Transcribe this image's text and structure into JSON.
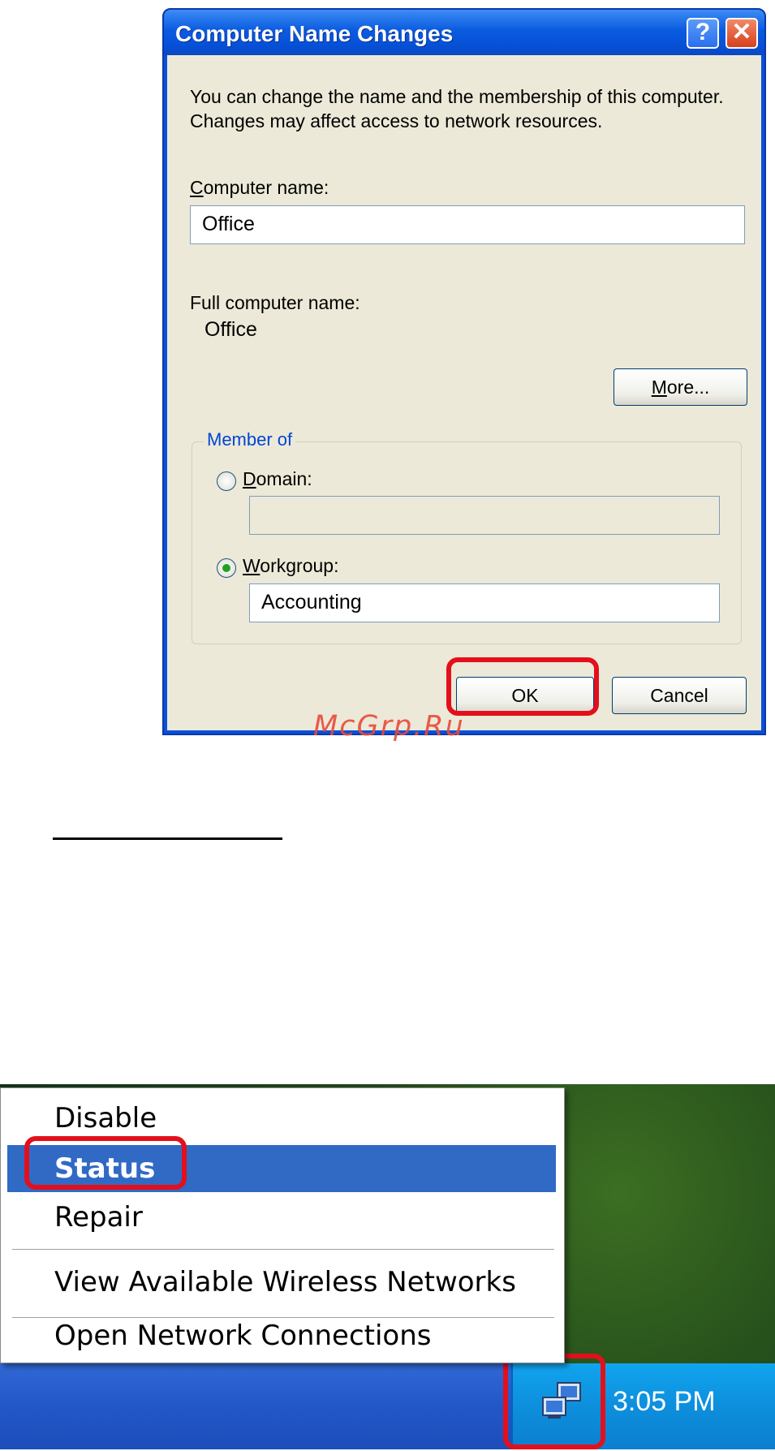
{
  "dialog": {
    "title": "Computer Name Changes",
    "help_label": "?",
    "close_label": "✕",
    "description": "You can change the name and the membership of this computer. Changes may affect access to network resources.",
    "computer_name_label_first": "C",
    "computer_name_label_rest": "omputer name:",
    "computer_name_value": "Office",
    "full_name_label": "Full computer name:",
    "full_name_value": "Office",
    "more_button_first": "M",
    "more_button_rest": "ore...",
    "member_of": {
      "legend": "Member of",
      "domain_label_first": "D",
      "domain_label_rest": "omain:",
      "domain_value": "",
      "workgroup_label_first": "W",
      "workgroup_label_rest": "orkgroup:",
      "workgroup_value": "Accounting",
      "selected": "workgroup"
    },
    "ok_label": "OK",
    "cancel_label": "Cancel"
  },
  "watermark": "McGrp.Ru",
  "context_menu": {
    "items": [
      {
        "label": "Disable"
      },
      {
        "label": "Status",
        "selected": true
      },
      {
        "label": "Repair"
      },
      {
        "label": "View Available Wireless Networks"
      },
      {
        "label": "Open Network Connections"
      }
    ]
  },
  "taskbar": {
    "tray_icon": "network-connection-icon",
    "clock": "3:05 PM"
  },
  "colors": {
    "highlight": "#e3101b",
    "menu_selection": "#316ac5",
    "title_bar": "#0a5be0"
  }
}
